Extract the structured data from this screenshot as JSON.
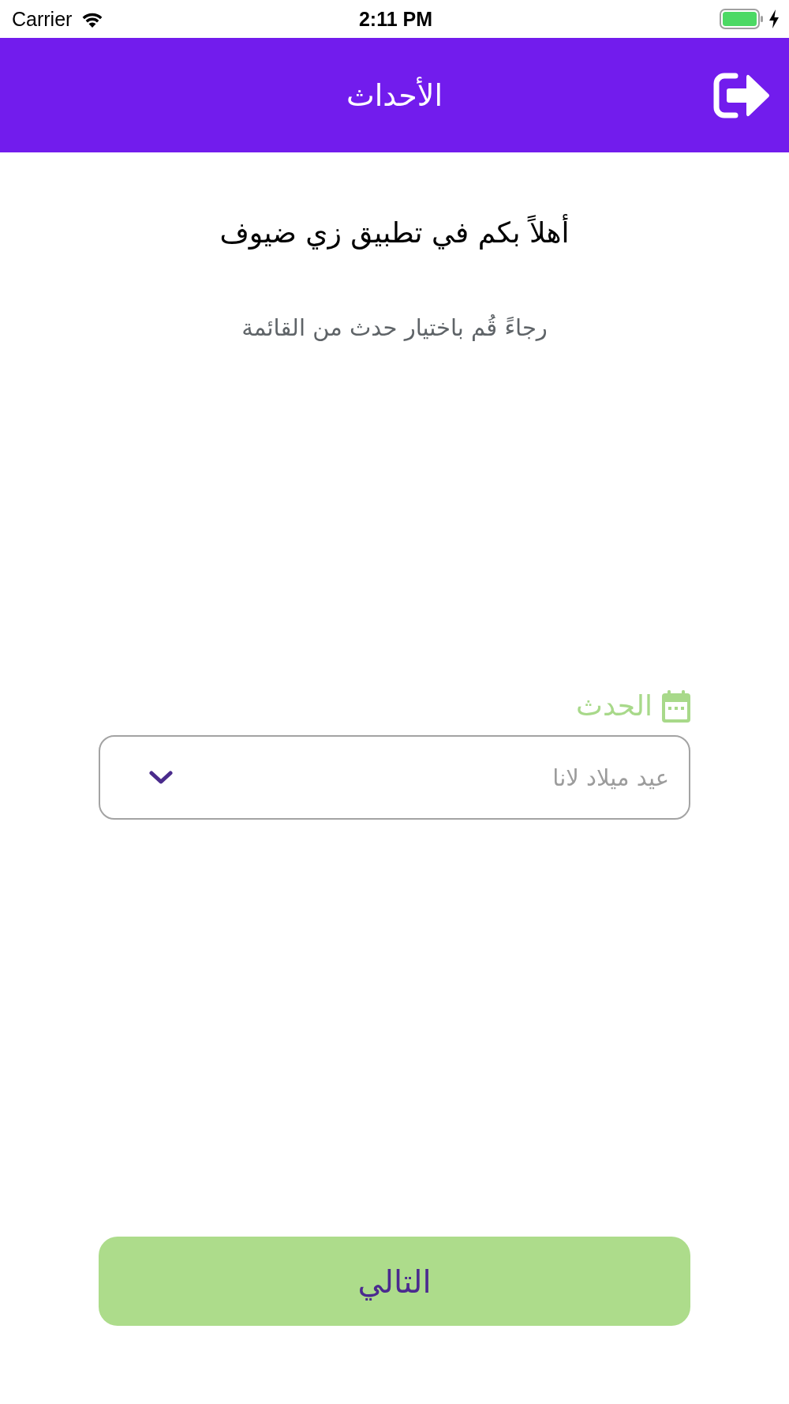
{
  "status_bar": {
    "carrier": "Carrier",
    "time": "2:11 PM"
  },
  "header": {
    "title": "الأحداث"
  },
  "welcome": {
    "heading": "أهلاً بكم في تطبيق زي ضيوف",
    "subtitle": "رجاءً قُم باختيار حدث من القائمة"
  },
  "event_field": {
    "label": "الحدث",
    "value": "عيد ميلاد لانا"
  },
  "next_button": {
    "label": "التالي"
  }
}
